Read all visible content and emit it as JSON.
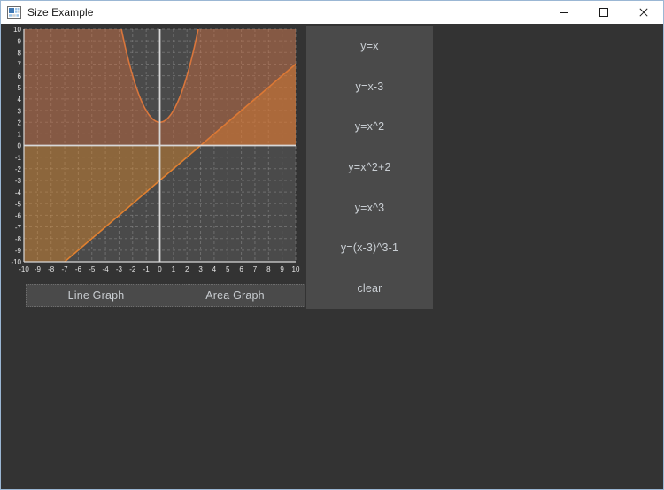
{
  "window": {
    "title": "Size Example",
    "icon": "application-window-icon",
    "controls": [
      {
        "name": "minimize-button",
        "glyph": "minimize-icon",
        "label": "Minimize"
      },
      {
        "name": "maximize-button",
        "glyph": "maximize-icon",
        "label": "Maximize"
      },
      {
        "name": "close-button",
        "glyph": "close-icon",
        "label": "Close"
      }
    ]
  },
  "tabs": [
    {
      "label": "Line Graph",
      "selected": false
    },
    {
      "label": "Area Graph",
      "selected": true
    }
  ],
  "function_buttons": [
    {
      "label": "y=x"
    },
    {
      "label": "y=x-3"
    },
    {
      "label": "y=x^2"
    },
    {
      "label": "y=x^2+2"
    },
    {
      "label": "y=x^3"
    },
    {
      "label": "y=(x-3)^3-1"
    },
    {
      "label": "clear"
    }
  ],
  "colors": {
    "window_background": "#333333",
    "panel_background": "#4a4a4a",
    "plot_background": "#4a4a4a",
    "grid": "#8d8d8d",
    "axis": "#d8d8d8",
    "curve_line": "#e08030",
    "curve_parabola": "#d9763c",
    "fill_line": "rgba(230,140,40,0.42)",
    "fill_parabola": "rgba(214,110,60,0.42)",
    "tick_label": "#e6e6e6",
    "button_text": "#c9ced3",
    "title_bar": "#ffffff",
    "title_text": "#1a1a1a"
  },
  "chart_data": {
    "type": "area",
    "title": "",
    "xlabel": "",
    "ylabel": "",
    "xlim": [
      -10,
      10
    ],
    "ylim": [
      -10,
      10
    ],
    "grid": true,
    "legend": "none",
    "xticks": [
      -10,
      -9,
      -8,
      -7,
      -6,
      -5,
      -4,
      -3,
      -2,
      -1,
      0,
      1,
      2,
      3,
      4,
      5,
      6,
      7,
      8,
      9,
      10
    ],
    "yticks": [
      -10,
      -9,
      -8,
      -7,
      -6,
      -5,
      -4,
      -3,
      -2,
      -1,
      0,
      1,
      2,
      3,
      4,
      5,
      6,
      7,
      8,
      9,
      10
    ],
    "xtick_labels": [
      "-10",
      "-9",
      "-8",
      "-7",
      "-6",
      "-5",
      "-4",
      "-3",
      "-2",
      "-1",
      "0",
      "1",
      "2",
      "3",
      "4",
      "5",
      "6",
      "7",
      "8",
      "9",
      "10"
    ],
    "ytick_labels": [
      "-10",
      "-9",
      "-8",
      "-7",
      "-6",
      "-5",
      "-4",
      "-3",
      "-2",
      "-1",
      "0",
      "1",
      "2",
      "3",
      "4",
      "5",
      "6",
      "7",
      "8",
      "9",
      "10"
    ],
    "series": [
      {
        "name": "y=x-3",
        "expression": "y=x-3",
        "type": "line-with-fill",
        "stroke": "#e08030",
        "fill": "rgba(230,140,40,0.42)",
        "fill_baseline": 0,
        "x": [
          -10,
          -9,
          -8,
          -7,
          -6,
          -5,
          -4,
          -3,
          -2,
          -1,
          0,
          1,
          2,
          3,
          4,
          5,
          6,
          7,
          8,
          9,
          10
        ],
        "values": [
          -13,
          -12,
          -11,
          -10,
          -9,
          -8,
          -7,
          -6,
          -5,
          -4,
          -3,
          -2,
          -1,
          0,
          1,
          2,
          3,
          4,
          5,
          6,
          7
        ],
        "x_intercept": 3,
        "y_intercept": -3
      },
      {
        "name": "y=x^2+2",
        "expression": "y=x^2+2",
        "type": "line-with-fill",
        "stroke": "#d9763c",
        "fill": "rgba(214,110,60,0.42)",
        "fill_baseline": 0,
        "x": [
          -10,
          -9,
          -8,
          -7,
          -6,
          -5,
          -4,
          -3,
          -2,
          -1,
          0,
          1,
          2,
          3,
          4,
          5,
          6,
          7,
          8,
          9,
          10
        ],
        "values": [
          102,
          83,
          66,
          51,
          38,
          27,
          18,
          11,
          6,
          3,
          2,
          3,
          6,
          11,
          18,
          27,
          38,
          51,
          66,
          83,
          102
        ],
        "vertex": [
          0,
          2
        ]
      }
    ]
  }
}
